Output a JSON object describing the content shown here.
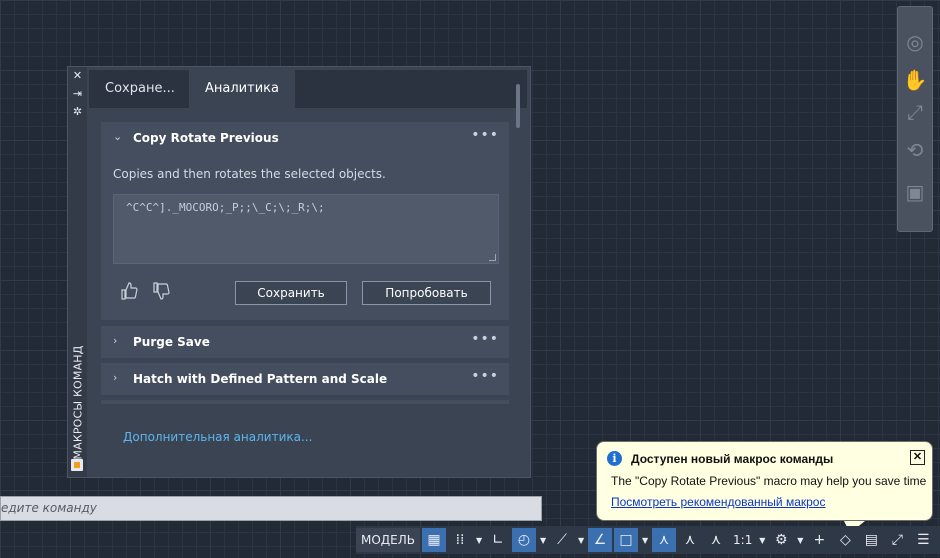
{
  "palette": {
    "side_title": "МАКРОСЫ КОМАНД",
    "tabs": [
      {
        "label": "Сохране..."
      },
      {
        "label": "Аналитика"
      }
    ],
    "cards": [
      {
        "title": "Copy Rotate Previous",
        "description": "Copies and then rotates the selected objects.",
        "macro": "^C^C^]._MOCORO;_P;;\\_C;\\;_R;\\;"
      },
      {
        "title": "Purge Save"
      },
      {
        "title": "Hatch with Defined Pattern and Scale"
      }
    ],
    "save_label": "Сохранить",
    "try_label": "Попробовать",
    "more_link": "Дополнительная аналитика..."
  },
  "cmdline": {
    "placeholder": "едите команду"
  },
  "statusbar": {
    "model_label": "МОДЕЛЬ",
    "scale_label": "1:1"
  },
  "balloon": {
    "title": "Доступен новый макрос команды",
    "message": "The \"Copy Rotate Previous\" macro may help you save time",
    "link": "Посмотреть рекомендованный макрос"
  },
  "colors": {
    "background": "#222a35",
    "panel": "#3b4453",
    "card": "#444e5e",
    "link": "#5cb6ee",
    "balloon": "#ffffe1",
    "status_active": "#3a6fb0"
  }
}
